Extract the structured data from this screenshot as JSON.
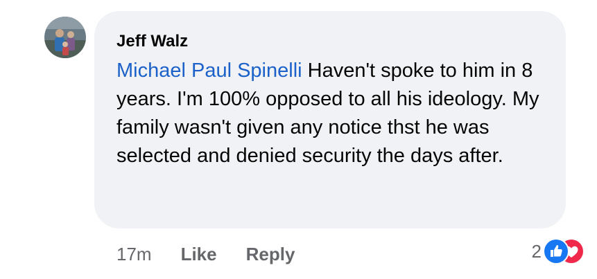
{
  "comment": {
    "author": "Jeff Walz",
    "mention": "Michael Paul Spinelli",
    "text": " Haven't spoke to him in 8 years.  I'm 100% opposed to all his ideology.  My family wasn't given any notice thst he was selected and denied security the days after."
  },
  "actions": {
    "timestamp": "17m",
    "like_label": "Like",
    "reply_label": "Reply"
  },
  "reactions": {
    "count": "2",
    "types": [
      "like-icon",
      "love-icon"
    ],
    "colors": {
      "like": "#1877f2",
      "love": "#f0284a"
    }
  },
  "colors": {
    "bubble_bg": "#f0f2f5",
    "mention": "#1b61c9",
    "secondary_text": "#65676b"
  }
}
